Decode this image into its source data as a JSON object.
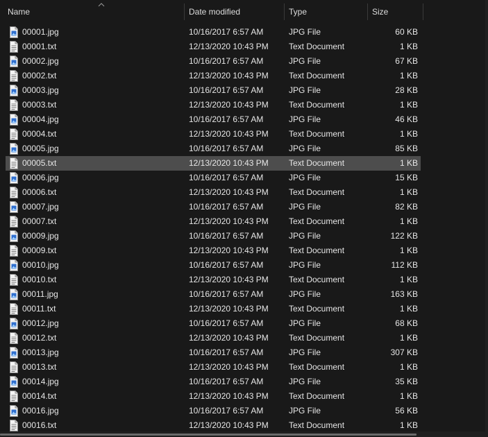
{
  "columns": {
    "name": "Name",
    "date": "Date modified",
    "type": "Type",
    "size": "Size"
  },
  "icons": {
    "jpg": "image-file-icon",
    "txt": "text-file-icon",
    "sort": "sort-ascending-icon"
  },
  "colors": {
    "background": "#191919",
    "selected_row": "#4d4d4d",
    "text": "#e6e6e6",
    "jpg_icon_accent": "#2f6fcf"
  },
  "selected_file": "00005.txt",
  "files": [
    {
      "name": "00001.jpg",
      "date": "10/16/2017 6:57 AM",
      "type": "JPG File",
      "size": "60 KB",
      "kind": "jpg"
    },
    {
      "name": "00001.txt",
      "date": "12/13/2020 10:43 PM",
      "type": "Text Document",
      "size": "1 KB",
      "kind": "txt"
    },
    {
      "name": "00002.jpg",
      "date": "10/16/2017 6:57 AM",
      "type": "JPG File",
      "size": "67 KB",
      "kind": "jpg"
    },
    {
      "name": "00002.txt",
      "date": "12/13/2020 10:43 PM",
      "type": "Text Document",
      "size": "1 KB",
      "kind": "txt"
    },
    {
      "name": "00003.jpg",
      "date": "10/16/2017 6:57 AM",
      "type": "JPG File",
      "size": "28 KB",
      "kind": "jpg"
    },
    {
      "name": "00003.txt",
      "date": "12/13/2020 10:43 PM",
      "type": "Text Document",
      "size": "1 KB",
      "kind": "txt"
    },
    {
      "name": "00004.jpg",
      "date": "10/16/2017 6:57 AM",
      "type": "JPG File",
      "size": "46 KB",
      "kind": "jpg"
    },
    {
      "name": "00004.txt",
      "date": "12/13/2020 10:43 PM",
      "type": "Text Document",
      "size": "1 KB",
      "kind": "txt"
    },
    {
      "name": "00005.jpg",
      "date": "10/16/2017 6:57 AM",
      "type": "JPG File",
      "size": "85 KB",
      "kind": "jpg"
    },
    {
      "name": "00005.txt",
      "date": "12/13/2020 10:43 PM",
      "type": "Text Document",
      "size": "1 KB",
      "kind": "txt"
    },
    {
      "name": "00006.jpg",
      "date": "10/16/2017 6:57 AM",
      "type": "JPG File",
      "size": "15 KB",
      "kind": "jpg"
    },
    {
      "name": "00006.txt",
      "date": "12/13/2020 10:43 PM",
      "type": "Text Document",
      "size": "1 KB",
      "kind": "txt"
    },
    {
      "name": "00007.jpg",
      "date": "10/16/2017 6:57 AM",
      "type": "JPG File",
      "size": "82 KB",
      "kind": "jpg"
    },
    {
      "name": "00007.txt",
      "date": "12/13/2020 10:43 PM",
      "type": "Text Document",
      "size": "1 KB",
      "kind": "txt"
    },
    {
      "name": "00009.jpg",
      "date": "10/16/2017 6:57 AM",
      "type": "JPG File",
      "size": "122 KB",
      "kind": "jpg"
    },
    {
      "name": "00009.txt",
      "date": "12/13/2020 10:43 PM",
      "type": "Text Document",
      "size": "1 KB",
      "kind": "txt"
    },
    {
      "name": "00010.jpg",
      "date": "10/16/2017 6:57 AM",
      "type": "JPG File",
      "size": "112 KB",
      "kind": "jpg"
    },
    {
      "name": "00010.txt",
      "date": "12/13/2020 10:43 PM",
      "type": "Text Document",
      "size": "1 KB",
      "kind": "txt"
    },
    {
      "name": "00011.jpg",
      "date": "10/16/2017 6:57 AM",
      "type": "JPG File",
      "size": "163 KB",
      "kind": "jpg"
    },
    {
      "name": "00011.txt",
      "date": "12/13/2020 10:43 PM",
      "type": "Text Document",
      "size": "1 KB",
      "kind": "txt"
    },
    {
      "name": "00012.jpg",
      "date": "10/16/2017 6:57 AM",
      "type": "JPG File",
      "size": "68 KB",
      "kind": "jpg"
    },
    {
      "name": "00012.txt",
      "date": "12/13/2020 10:43 PM",
      "type": "Text Document",
      "size": "1 KB",
      "kind": "txt"
    },
    {
      "name": "00013.jpg",
      "date": "10/16/2017 6:57 AM",
      "type": "JPG File",
      "size": "307 KB",
      "kind": "jpg"
    },
    {
      "name": "00013.txt",
      "date": "12/13/2020 10:43 PM",
      "type": "Text Document",
      "size": "1 KB",
      "kind": "txt"
    },
    {
      "name": "00014.jpg",
      "date": "10/16/2017 6:57 AM",
      "type": "JPG File",
      "size": "35 KB",
      "kind": "jpg"
    },
    {
      "name": "00014.txt",
      "date": "12/13/2020 10:43 PM",
      "type": "Text Document",
      "size": "1 KB",
      "kind": "txt"
    },
    {
      "name": "00016.jpg",
      "date": "10/16/2017 6:57 AM",
      "type": "JPG File",
      "size": "56 KB",
      "kind": "jpg"
    },
    {
      "name": "00016.txt",
      "date": "12/13/2020 10:43 PM",
      "type": "Text Document",
      "size": "1 KB",
      "kind": "txt"
    }
  ]
}
